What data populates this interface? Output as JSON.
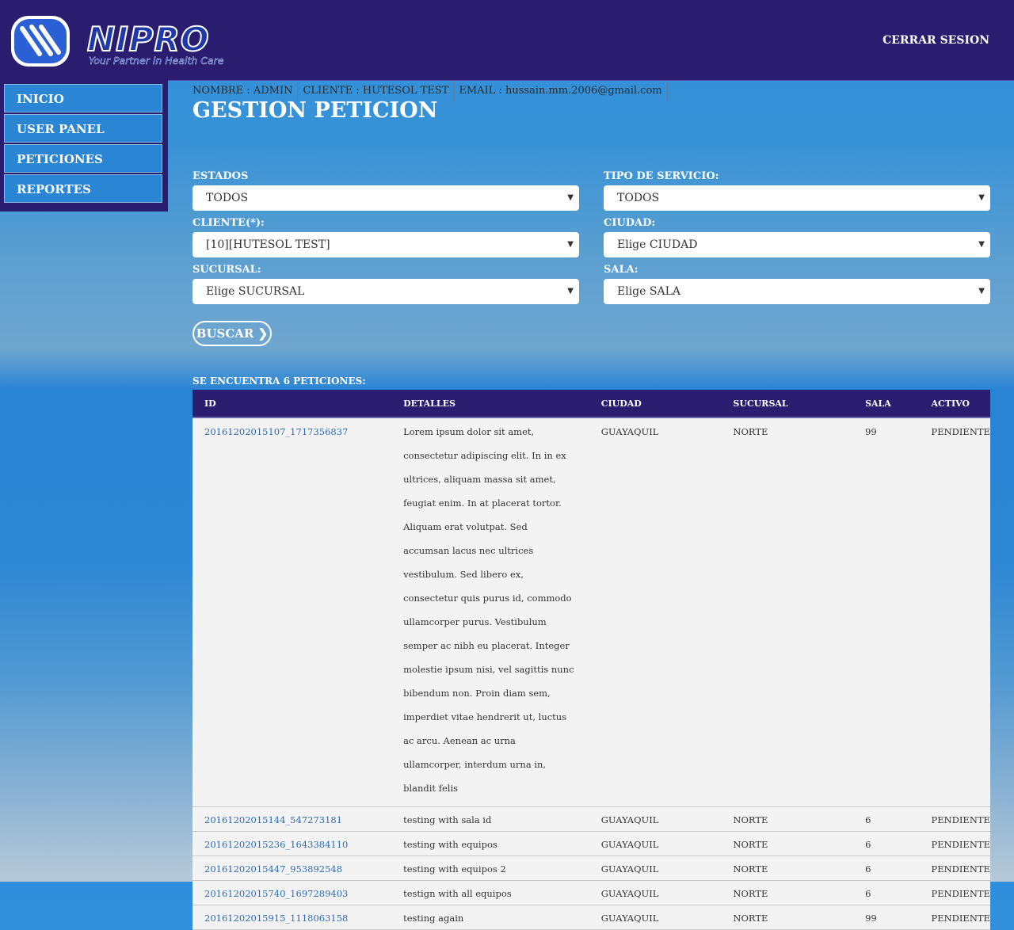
{
  "header": {
    "brand": "NIPRO",
    "tagline": "Your Partner in Health Care",
    "logout_label": "CERRAR SESION"
  },
  "sidebar": {
    "items": [
      {
        "label": "INICIO"
      },
      {
        "label": "USER PANEL"
      },
      {
        "label": "PETICIONES"
      },
      {
        "label": "REPORTES"
      }
    ]
  },
  "user": {
    "nombre": "NOMBRE : ADMIN",
    "cliente": "CLIENTE : HUTESOL TEST",
    "email": "EMAIL : hussain.mm.2006@gmail.com"
  },
  "page": {
    "title": "GESTION PETICION"
  },
  "filters": {
    "estados": {
      "label": "ESTADOS",
      "value": "TODOS"
    },
    "tipo_servicio": {
      "label": "TIPO DE SERVICIO:",
      "value": "TODOS"
    },
    "cliente": {
      "label": "CLIENTE(*):",
      "value": "[10][HUTESOL TEST]"
    },
    "ciudad": {
      "label": "CIUDAD:",
      "value": "Elige CIUDAD"
    },
    "sucursal": {
      "label": "SUCURSAL:",
      "value": "Elige SUCURSAL"
    },
    "sala": {
      "label": "SALA:",
      "value": "Elige SALA"
    },
    "caret": "▼"
  },
  "search": {
    "button_label": "BUSCAR",
    "arrow": "❯"
  },
  "results": {
    "summary": "SE ENCUENTRA 6 PETICIONES:",
    "columns": [
      "ID",
      "DETALLES",
      "CIUDAD",
      "SUCURSAL",
      "SALA",
      "ACTIVO"
    ],
    "rows": [
      {
        "id": "20161202015107_1717356837",
        "detalles": "Lorem ipsum dolor sit amet, consectetur adipiscing elit. In in ex ultrices, aliquam massa sit amet, feugiat enim. In at placerat tortor. Aliquam erat volutpat. Sed accumsan lacus nec ultrices vestibulum. Sed libero ex, consectetur quis purus id, commodo ullamcorper purus. Vestibulum semper ac nibh eu placerat. Integer molestie ipsum nisi, vel sagittis nunc bibendum non. Proin diam sem, imperdiet vitae hendrerit ut, luctus ac arcu. Aenean ac urna ullamcorper, interdum urna in, blandit felis",
        "ciudad": "GUAYAQUIL",
        "sucursal": "NORTE",
        "sala": "99",
        "activo": "PENDIENTE"
      },
      {
        "id": "20161202015144_547273181",
        "detalles": "testing with sala id",
        "ciudad": "GUAYAQUIL",
        "sucursal": "NORTE",
        "sala": "6",
        "activo": "PENDIENTE"
      },
      {
        "id": "20161202015236_1643384110",
        "detalles": "testing with equipos",
        "ciudad": "GUAYAQUIL",
        "sucursal": "NORTE",
        "sala": "6",
        "activo": "PENDIENTE"
      },
      {
        "id": "20161202015447_953892548",
        "detalles": "testing with equipos 2",
        "ciudad": "GUAYAQUIL",
        "sucursal": "NORTE",
        "sala": "6",
        "activo": "PENDIENTE"
      },
      {
        "id": "20161202015740_1697289403",
        "detalles": "testign with all equipos",
        "ciudad": "GUAYAQUIL",
        "sucursal": "NORTE",
        "sala": "6",
        "activo": "PENDIENTE"
      },
      {
        "id": "20161202015915_1118063158",
        "detalles": "testing again",
        "ciudad": "GUAYAQUIL",
        "sucursal": "NORTE",
        "sala": "99",
        "activo": "PENDIENTE"
      }
    ]
  },
  "colors": {
    "header_bg": "#2a1c6f",
    "accent_blue": "#2a86d4",
    "link": "#2c6bb5"
  }
}
